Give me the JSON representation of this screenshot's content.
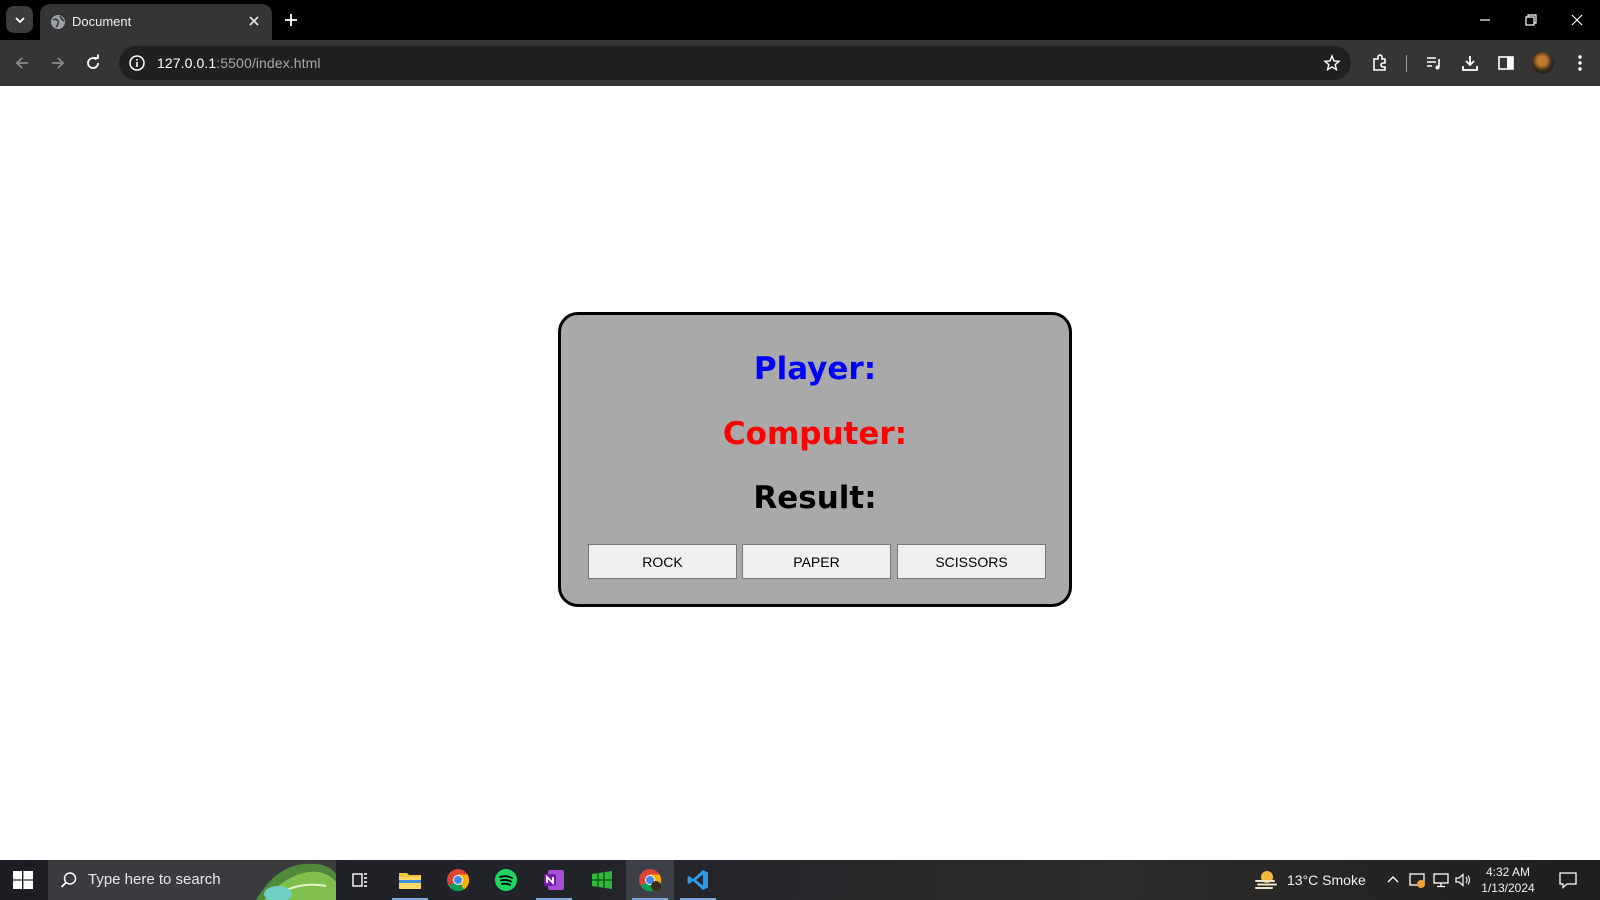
{
  "browser": {
    "tab_title": "Document",
    "url_host": "127.0.0.1",
    "url_rest": ":5500/index.html"
  },
  "game": {
    "player_label": "Player:",
    "computer_label": "Computer:",
    "result_label": "Result:",
    "buttons": {
      "rock": "ROCK",
      "paper": "PAPER",
      "scissors": "SCISSORS"
    },
    "colors": {
      "player": "#0000ff",
      "computer": "#ff0000",
      "result": "#000000",
      "card_background": "#a9a9a9"
    }
  },
  "taskbar": {
    "search_placeholder": "Type here to search",
    "apps": [
      "file-explorer",
      "chrome",
      "spotify",
      "onenote",
      "sheets-app",
      "chrome-active",
      "vscode"
    ],
    "weather": "13°C  Smoke",
    "time": "4:32 AM",
    "date": "1/13/2024"
  }
}
